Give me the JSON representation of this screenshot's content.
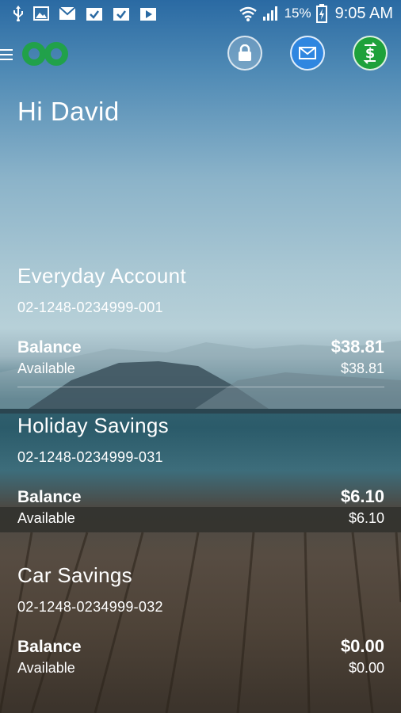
{
  "status_bar": {
    "battery": "15%",
    "time": "9:05 AM",
    "left_icons": [
      "usb-icon",
      "image-icon",
      "gmail-icon",
      "task-icon",
      "task-icon",
      "play-store-icon"
    ],
    "right_icons": [
      "wifi-icon",
      "signal-icon",
      "battery-charging-icon"
    ]
  },
  "header": {
    "icons": [
      "menu-icon",
      "logo-icon",
      "lock-icon",
      "mail-icon",
      "transfer-icon"
    ],
    "colors": {
      "mail": "#2f86e0",
      "transfer": "#1ea13a",
      "logo": "#21a14a"
    }
  },
  "greeting": "Hi David",
  "accounts": [
    {
      "name": "Everyday Account",
      "number": "02-1248-0234999-001",
      "balance_label": "Balance",
      "balance": "$38.81",
      "available_label": "Available",
      "available": "$38.81"
    },
    {
      "name": "Holiday Savings",
      "number": "02-1248-0234999-031",
      "balance_label": "Balance",
      "balance": "$6.10",
      "available_label": "Available",
      "available": "$6.10"
    },
    {
      "name": "Car Savings",
      "number": "02-1248-0234999-032",
      "balance_label": "Balance",
      "balance": "$0.00",
      "available_label": "Available",
      "available": "$0.00"
    }
  ]
}
